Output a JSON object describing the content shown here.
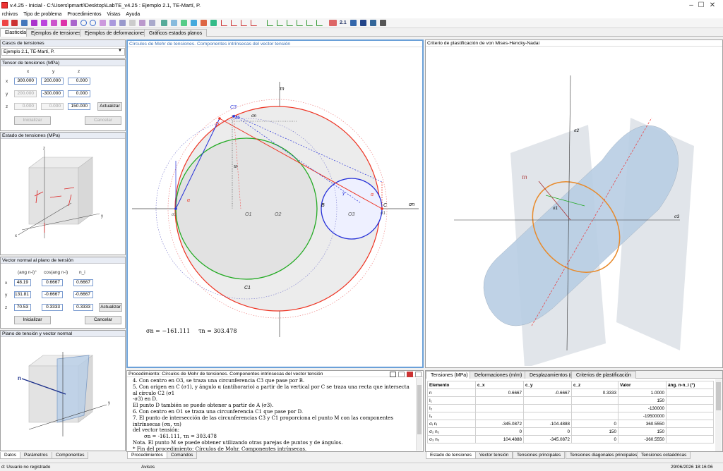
{
  "window": {
    "title": "v.4.25 - Inicial - C:\\Users\\pmarti\\Desktop\\LabTE_v4.25 : Ejemplo 2.1, TE-Martí, P."
  },
  "menu": [
    "rchivos",
    "Tipo de problema",
    "Procedimientos",
    "Vistas",
    "Ayuda"
  ],
  "tabs": [
    "Elasticidad",
    "Ejemplos de tensiones",
    "Ejemplos de deformaciones",
    "Gráficos estados planos"
  ],
  "toolbar": {
    "zoom_label": "2.1"
  },
  "left": {
    "cases_header": "Casos de tensiones",
    "cases_value": "Ejemplo 2.1, TE-Martí, P.",
    "tensor_header": "Tensor de tensiones (MPa)",
    "cols": [
      "x",
      "y",
      "z"
    ],
    "rows": [
      "x",
      "y",
      "z"
    ],
    "tensor": [
      [
        "300.000",
        "200.000",
        "0.000"
      ],
      [
        "200.000",
        "-300.000",
        "0.000"
      ],
      [
        "0.000",
        "0.000",
        "150.000"
      ]
    ],
    "update_label": "Actualizar",
    "init_label": "Inicializar",
    "cancel_label": "Cancelar",
    "state_header": "Estado de tensiones (MPa)",
    "normal_header": "Vector normal al plano de tensión",
    "normal_cols": [
      "(ang n-i)°",
      "cos(ang n-i)",
      "n_i"
    ],
    "normal": [
      [
        "48.19",
        "0.6667",
        "0.6667"
      ],
      [
        "131.81",
        "-0.6667",
        "-0.6667"
      ],
      [
        "70.53",
        "0.3333",
        "0.3333"
      ]
    ],
    "plane_header": "Plano de tensión y vector normal",
    "bottom_tabs": [
      "Datos",
      "Parámetros",
      "Componentes"
    ]
  },
  "mohr": {
    "header": "Círculos de Mohr de tensiones. Componentes intrínsecas del vector tensión",
    "sigma_n": "σn = −161.111",
    "tau_n": "τn = 303.478",
    "axis_sigma": "σn",
    "axis_tau": "τn",
    "labels": {
      "O1": "O1",
      "O2": "O2",
      "O3": "O3",
      "B": "B",
      "C": "C",
      "C3": "C3",
      "C1": "C1",
      "C2": "C2",
      "D": "D",
      "M": "M",
      "alpha": "α",
      "gamma": "γ",
      "s1": "σ1",
      "s3": "σ3",
      "sn": "σn",
      "tn": "τn"
    }
  },
  "vonmises": {
    "header": "Criterio de plastificación de von Mises-Hencky-Nadai",
    "axes": [
      "σ1",
      "σ2",
      "σ3"
    ],
    "tau_label": "τn"
  },
  "procedure": {
    "header": "Procedimiento: Círculos de Mohr de tensiones. Componentes intrínsecas del vector tensión",
    "lines": [
      "4. Con centro en O3, se traza una circunferencia C3 que pase por B.",
      "5. Con origen en C (σ1), y ángulo α (antihorario) a partir de la vertical por C se traza una recta que intersecta al círculo C2 (σ1",
      "-σ3) en D.",
      "El punto D también se puede obtener a partir de A (σ3).",
      "6. Con centro en O1 se traza una circunferencia C1 que pase por D.",
      "7. El punto de intersección de las circunferencias C3 y C1 proporciona el punto M con las componentes intrínsecas (σn, τn)",
      "del vector tensión:",
      "σn = -161.111, τn = 303.478",
      "Nota. El punto M se puede obtener utilizando otras parejas de puntos y de ángulos.",
      "* Fin del procedimiento: Círculos de Mohr. Componentes intrínsecas."
    ],
    "tabs": [
      "Procedimientos",
      "Comandos"
    ]
  },
  "results": {
    "tabs": [
      "Tensiones (MPa)",
      "Deformaciones (m/m)",
      "Desplazamientos (m)",
      "Criterios de plastificación"
    ],
    "columns": [
      "Elemento",
      "c_x",
      "c_y",
      "c_z",
      "Valor",
      "áng. n-n_i (°)"
    ],
    "rows": [
      [
        "n",
        "0.6667",
        "-0.6667",
        "0.3333",
        "1.0000",
        ""
      ],
      [
        "I₁",
        "",
        "",
        "",
        "150",
        ""
      ],
      [
        "I₂",
        "",
        "",
        "",
        "-130000",
        ""
      ],
      [
        "I₃",
        "",
        "",
        "",
        "-19500000",
        ""
      ],
      [
        "σᵢ nᵢ",
        "-345.0872",
        "-104.4888",
        "0",
        "360.5550",
        ""
      ],
      [
        "σ₂ n₂",
        "0",
        "0",
        "150",
        "150",
        ""
      ],
      [
        "σ₃ n₃",
        "104.4888",
        "-345.0872",
        "0",
        "-360.5550",
        ""
      ]
    ],
    "bottom_tabs": [
      "Estado de tensiones",
      "Vector tensión",
      "Tensiones principales",
      "Tensiones diagonales principales",
      "Tensiones octaédricas"
    ]
  },
  "status": {
    "user": "d: Usuario no registrado",
    "mid": "Avisos",
    "datetime": "29/06/2026 18:16:06"
  }
}
